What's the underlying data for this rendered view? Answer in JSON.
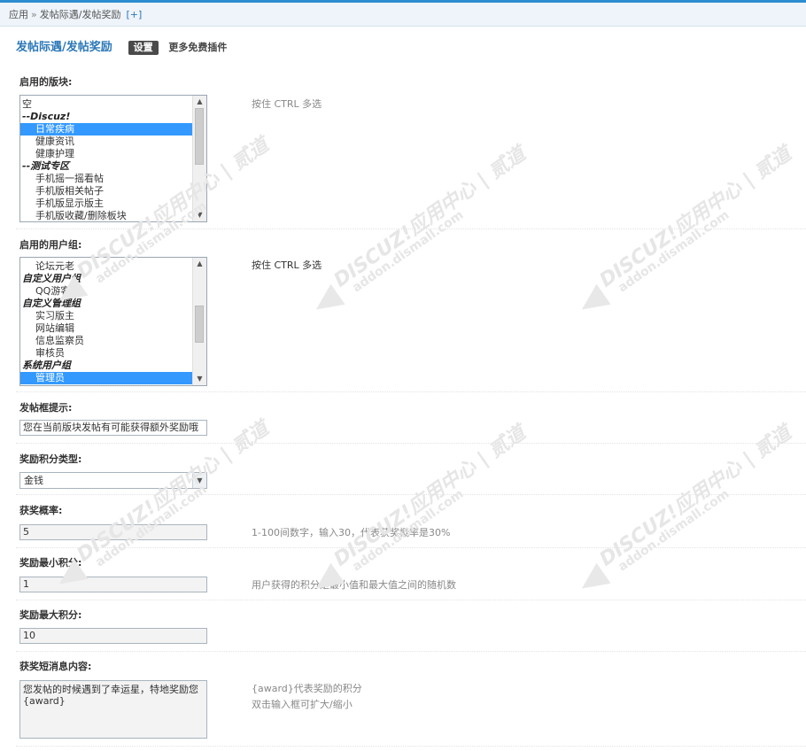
{
  "breadcrumb": {
    "items": [
      "应用",
      "发帖际遇/发帖奖励"
    ],
    "separator": "»",
    "add_label": "[+]"
  },
  "header": {
    "title": "发帖际遇/发帖奖励",
    "settings_label": "设置",
    "more_label": "更多免费插件"
  },
  "watermark": {
    "brand": "DISCUZ!应用中心 | 贰道",
    "site": "addon.dismall.com"
  },
  "forums": {
    "label": "启用的版块:",
    "hint": "按住 CTRL 多选",
    "options": [
      {
        "text": "空",
        "type": "plain",
        "selected": false
      },
      {
        "text": "--Discuz!",
        "type": "group",
        "selected": false
      },
      {
        "text": "日常疾病",
        "type": "indent",
        "selected": true
      },
      {
        "text": "健康资讯",
        "type": "indent",
        "selected": false
      },
      {
        "text": "健康护理",
        "type": "indent",
        "selected": false
      },
      {
        "text": "--测试专区",
        "type": "group",
        "selected": false
      },
      {
        "text": "手机摇一摇看帖",
        "type": "indent",
        "selected": false
      },
      {
        "text": "手机版相关帖子",
        "type": "indent",
        "selected": false
      },
      {
        "text": "手机版显示版主",
        "type": "indent",
        "selected": false
      },
      {
        "text": "手机版收藏/删除板块",
        "type": "indent",
        "selected": false
      }
    ]
  },
  "usergroups": {
    "label": "启用的用户组:",
    "hint": "按住 CTRL 多选",
    "options": [
      {
        "text": "论坛元老",
        "type": "indent",
        "selected": false
      },
      {
        "text": "自定义用户组",
        "type": "group",
        "selected": false
      },
      {
        "text": "QQ游客",
        "type": "indent",
        "selected": false
      },
      {
        "text": "自定义管理组",
        "type": "group",
        "selected": false
      },
      {
        "text": "实习版主",
        "type": "indent",
        "selected": false
      },
      {
        "text": "网站编辑",
        "type": "indent",
        "selected": false
      },
      {
        "text": "信息监察员",
        "type": "indent",
        "selected": false
      },
      {
        "text": "审核员",
        "type": "indent",
        "selected": false
      },
      {
        "text": "系统用户组",
        "type": "group",
        "selected": false
      },
      {
        "text": "管理员",
        "type": "indent",
        "selected": true
      }
    ]
  },
  "post_hint": {
    "label": "发帖框提示:",
    "value": "您在当前版块发帖有可能获得额外奖励哦"
  },
  "credit_type": {
    "label": "奖励积分类型:",
    "selected": "金钱"
  },
  "probability": {
    "label": "获奖概率:",
    "value": "5",
    "hint": "1-100间数字，输入30，代表获奖概率是30%"
  },
  "min_credit": {
    "label": "奖励最小积分:",
    "value": "1",
    "hint": "用户获得的积分是最小值和最大值之间的随机数"
  },
  "max_credit": {
    "label": "奖励最大积分:",
    "value": "10"
  },
  "message": {
    "label": "获奖短消息内容:",
    "value": "您发帖的时候遇到了幸运星，特地奖励您\n{award}",
    "hint1": "{award}代表奖励的积分",
    "hint2": "双击输入框可扩大/缩小"
  }
}
